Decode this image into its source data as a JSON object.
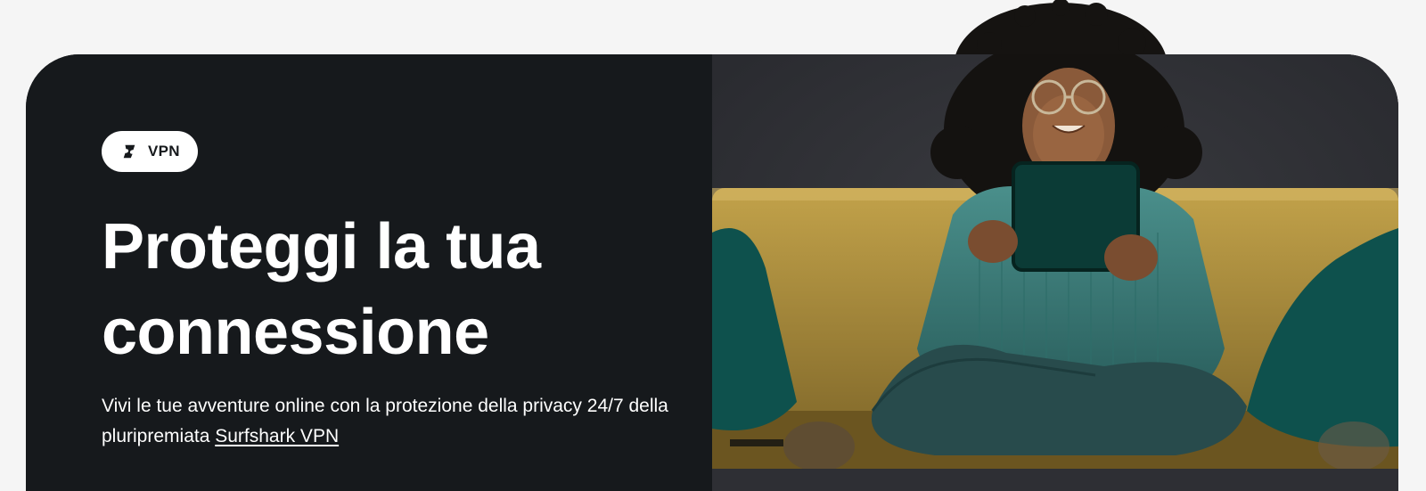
{
  "badge": {
    "label": "VPN",
    "icon": "surfshark-logo-icon"
  },
  "headline": {
    "line1": "Proteggi la tua",
    "line2": "connessione"
  },
  "subtext": {
    "before_link": "Vivi le tue avventure online con la protezione della privacy 24/7 della pluripremiata ",
    "link_label": "Surfshark VPN"
  },
  "photo": {
    "icon": "woman-on-sofa-with-tablet-image"
  },
  "colors": {
    "page_bg": "#f5f5f5",
    "hero_dark": "#16191c",
    "photo_bg": "#2e2f34",
    "sofa": "#b0923a",
    "pillow": "#0f5a55",
    "sweater": "#3c7f7c"
  }
}
